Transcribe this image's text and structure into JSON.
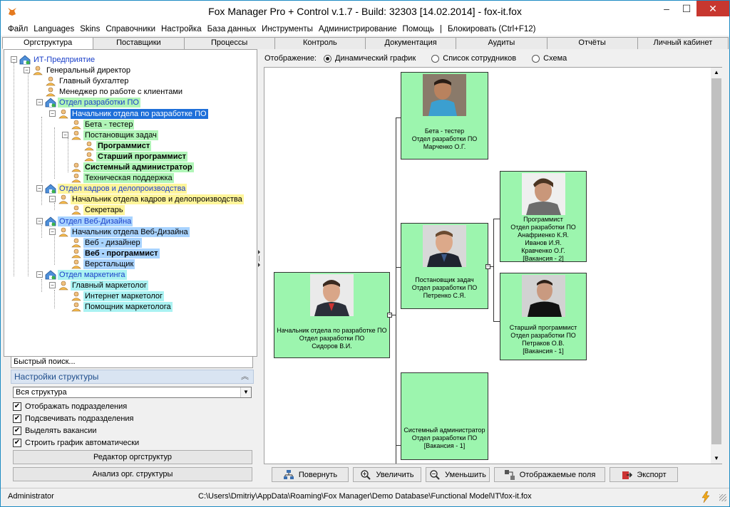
{
  "window": {
    "title": "Fox Manager Pro + Control v.1.7 - Build: 32303 [14.02.2014]  - fox-it.fox",
    "minimize": "–",
    "maximize": "☐",
    "close": "✕"
  },
  "menu": [
    "Файл",
    "Languages",
    "Skins",
    "Справочники",
    "Настройка",
    "База данных",
    "Инструменты",
    "Администрирование",
    "Помощь",
    "|",
    "Блокировать (Ctrl+F12)"
  ],
  "tabs": [
    {
      "label": "Оргструктура",
      "active": true
    },
    {
      "label": "Поставщики"
    },
    {
      "label": "Процессы"
    },
    {
      "label": "Контроль"
    },
    {
      "label": "Документация"
    },
    {
      "label": "Аудиты"
    },
    {
      "label": "Отчёты"
    },
    {
      "label": "Личный кабинет"
    }
  ],
  "tree": [
    {
      "label": "ИТ-Предприятие",
      "type": "root"
    },
    {
      "label": "Генеральный директор",
      "type": "person"
    },
    {
      "label": "Главный бухгалтер",
      "type": "person"
    },
    {
      "label": "Менеджер по работе с клиентами",
      "type": "person"
    },
    {
      "label": "Отдел разработки ПО",
      "type": "dept"
    },
    {
      "label": "Начальник отдела по разработке ПО",
      "type": "selected"
    },
    {
      "label": "Бета - тестер",
      "type": "person"
    },
    {
      "label": "Постановщик задач",
      "type": "person"
    },
    {
      "label": "Программист",
      "type": "vacancy"
    },
    {
      "label": "Старший программист",
      "type": "vacancy"
    },
    {
      "label": "Системный администратор",
      "type": "vacancy"
    },
    {
      "label": "Техническая поддержка",
      "type": "person"
    },
    {
      "label": "Отдел кадров и делопроизводства",
      "type": "dept"
    },
    {
      "label": "Начальник отдела кадров и делопроизводства",
      "type": "person"
    },
    {
      "label": "Секретарь",
      "type": "person"
    },
    {
      "label": "Отдел Веб-Дизайна",
      "type": "dept"
    },
    {
      "label": "Начальник отдела Веб-Дизайна",
      "type": "person"
    },
    {
      "label": "Веб - дизайнер",
      "type": "person"
    },
    {
      "label": "Веб - программист",
      "type": "vacancy"
    },
    {
      "label": "Верстальщик",
      "type": "person"
    },
    {
      "label": "Отдел маркетинга",
      "type": "dept"
    },
    {
      "label": "Главный маркетолог",
      "type": "person"
    },
    {
      "label": "Интернет маркетолог",
      "type": "person"
    },
    {
      "label": "Помощник маркетолога",
      "type": "person"
    }
  ],
  "colors": {
    "dev_dept": "#b0f5b7",
    "hr_dept": "#fff59a",
    "web_dept": "#a8d3ff",
    "mkt_dept": "#aaf2f2",
    "selected": "#1e6fd9",
    "card": "#9cf5ae",
    "tree_link": "#1a3fc9"
  },
  "search": {
    "placeholder": "Быстрый поиск..."
  },
  "settings": {
    "header": "Настройки структуры",
    "scope": "Вся структура",
    "checks": [
      {
        "label": "Отображать подразделения",
        "checked": true
      },
      {
        "label": "Подсвечивать подразделения",
        "checked": true
      },
      {
        "label": "Выделять вакансии",
        "checked": true
      },
      {
        "label": "Строить график автоматически",
        "checked": true
      }
    ],
    "editor_button": "Редактор оргструктур",
    "analysis_button": "Анализ орг. структуры"
  },
  "view": {
    "label": "Отображение:",
    "options": [
      {
        "label": "Динамический график",
        "selected": true
      },
      {
        "label": "Список сотрудников",
        "selected": false
      },
      {
        "label": "Схема",
        "selected": false
      }
    ]
  },
  "cards": {
    "root": {
      "title": "Начальник отдела по разработке ПО",
      "dept": "Отдел разработки ПО",
      "person": "Сидоров В.И."
    },
    "beta": {
      "title": "Бета - тестер",
      "dept": "Отдел разработки ПО",
      "person": "Марченко О.Г."
    },
    "task": {
      "title": "Постановщик задач",
      "dept": "Отдел разработки ПО",
      "person": "Петренко С.Я."
    },
    "sysadm": {
      "title": "Системный администратор",
      "dept": "Отдел разработки ПО",
      "person": "[Вакансия - 1]"
    },
    "prog": {
      "title": "Программист",
      "dept": "Отдел разработки ПО",
      "people": [
        "Анафриенко К.Я.",
        "Иванов И.Я.",
        "Кравченко О.Г."
      ],
      "vacancy": "[Вакансия - 2]"
    },
    "senior": {
      "title": "Старший программист",
      "dept": "Отдел разработки ПО",
      "person": "Петраков О.В.",
      "vacancy": "[Вакансия - 1]"
    }
  },
  "toolbar": {
    "rotate": "Повернуть",
    "zoom_in": "Увеличить",
    "zoom_out": "Уменьшить",
    "fields": "Отображаемые поля",
    "export": "Экспорт"
  },
  "status": {
    "user": "Administrator",
    "path": "C:\\Users\\Dmitriy\\AppData\\Roaming\\Fox Manager\\Demo Database\\Functional Model\\IT\\fox-it.fox"
  }
}
